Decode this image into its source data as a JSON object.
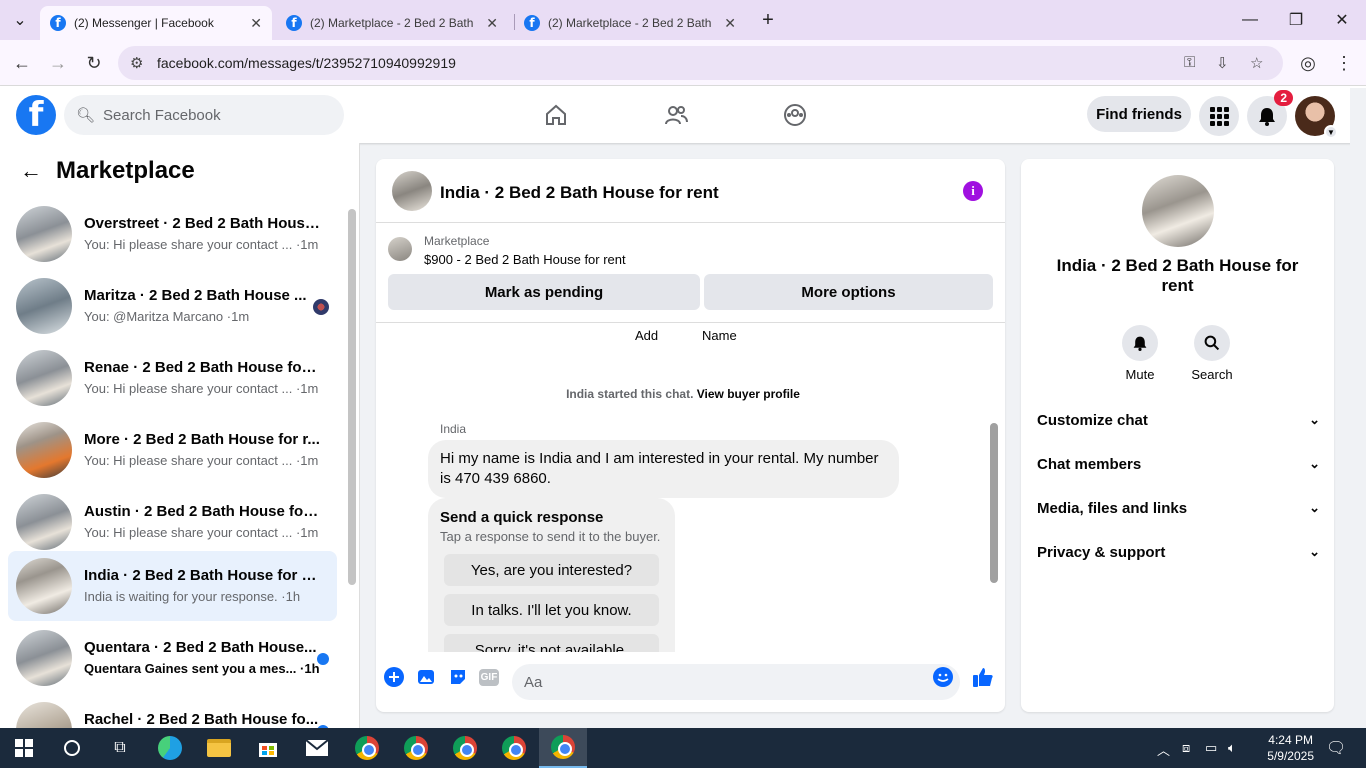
{
  "browser": {
    "tabs": [
      {
        "label": "(2) Messenger | Facebook",
        "active": true
      },
      {
        "label": "(2) Marketplace - 2 Bed 2 Bath",
        "active": false
      },
      {
        "label": "(2) Marketplace - 2 Bed 2 Bath",
        "active": false
      }
    ],
    "new_tab": "+",
    "url": "facebook.com/messages/t/23952710940992919"
  },
  "fb": {
    "logo": "f",
    "search_placeholder": "Search Facebook",
    "find_friends": "Find friends",
    "notification_count": "2"
  },
  "sidebar": {
    "title": "Marketplace",
    "conversations": [
      {
        "title": "Overstreet · 2 Bed 2 Bath House ...",
        "subtitle": "You: Hi please share your contact ... ·1m",
        "unread": false
      },
      {
        "title": "Maritza · 2 Bed 2 Bath House ...",
        "subtitle": "You: @Maritza Marcano ·1m",
        "unread": false
      },
      {
        "title": "Renae · 2 Bed 2 Bath House for r...",
        "subtitle": "You: Hi please share your contact ... ·1m",
        "unread": false
      },
      {
        "title": "More · 2 Bed 2 Bath House for r...",
        "subtitle": "You: Hi please share your contact ... ·1m",
        "unread": false
      },
      {
        "title": "Austin · 2 Bed 2 Bath House for ...",
        "subtitle": "You: Hi please share your contact ... ·1m",
        "unread": false
      },
      {
        "title": "India · 2 Bed 2 Bath House for re...",
        "subtitle": "India is waiting for your response. ·1h",
        "unread": false
      },
      {
        "title": "Quentara · 2 Bed 2 Bath House...",
        "subtitle": "Quentara Gaines sent you a mes... ·1h",
        "unread": true
      },
      {
        "title": "Rachel · 2 Bed 2 Bath House fo...",
        "subtitle": "",
        "unread": true
      }
    ]
  },
  "chat": {
    "title": "India · 2 Bed 2 Bath House for rent",
    "listing_source": "Marketplace",
    "listing_price": "$900 - 2 Bed 2 Bath House for rent",
    "mark_pending": "Mark as pending",
    "more_options": "More options",
    "cut_label_add": "Add",
    "cut_label_name": "Name",
    "started_text": "India started this chat.",
    "view_profile": "View buyer profile",
    "sender": "India",
    "message": "Hi my name is India and I am interested in your rental. My number is 470 439 6860.",
    "quick_title": "Send a quick response",
    "quick_subtitle": "Tap a response to send it to the buyer.",
    "quick_replies": [
      "Yes, are you interested?",
      "In talks. I'll let you know.",
      "Sorry, it's not available."
    ],
    "composer_placeholder": "Aa",
    "gif_label": "GIF"
  },
  "info": {
    "title": "India · 2 Bed 2 Bath House for rent",
    "mute": "Mute",
    "search": "Search",
    "sections": [
      "Customize chat",
      "Chat members",
      "Media, files and links",
      "Privacy & support"
    ]
  },
  "taskbar": {
    "time": "4:24 PM",
    "date": "5/9/2025"
  },
  "colors": {
    "fb_blue": "#1877f2",
    "messenger_purple": "#a010e0",
    "selected_row": "#e8f1fd"
  }
}
